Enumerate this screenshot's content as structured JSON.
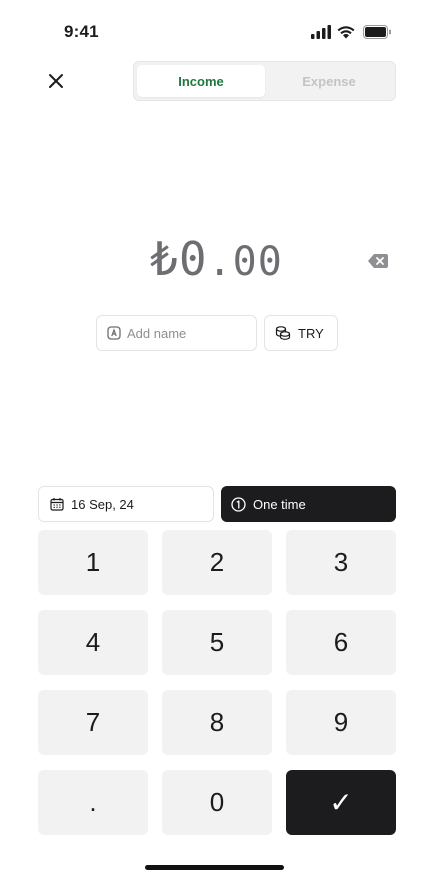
{
  "status_bar": {
    "time": "9:41"
  },
  "header": {
    "close_icon": "close-icon",
    "tabs": [
      {
        "label": "Income",
        "active": true,
        "color": "#1e7a3c"
      },
      {
        "label": "Expense",
        "active": false,
        "color": "#c4c4c7"
      }
    ]
  },
  "amount": {
    "currency_symbol": "₺",
    "integer": "0",
    "decimal": ".00"
  },
  "name_input": {
    "placeholder": "Add name",
    "value": ""
  },
  "currency": {
    "code": "TRY",
    "icon": "coins-icon"
  },
  "date": {
    "label": "16 Sep, 24",
    "icon": "calendar-icon"
  },
  "frequency": {
    "label": "One time",
    "icon": "one-circle-icon"
  },
  "keypad": {
    "keys": [
      "1",
      "2",
      "3",
      "4",
      "5",
      "6",
      "7",
      "8",
      "9",
      ".",
      "0"
    ],
    "confirm": "✓"
  },
  "colors": {
    "accent_income": "#1e7a3c",
    "dark": "#1c1c1e",
    "key_bg": "#f2f2f3"
  }
}
